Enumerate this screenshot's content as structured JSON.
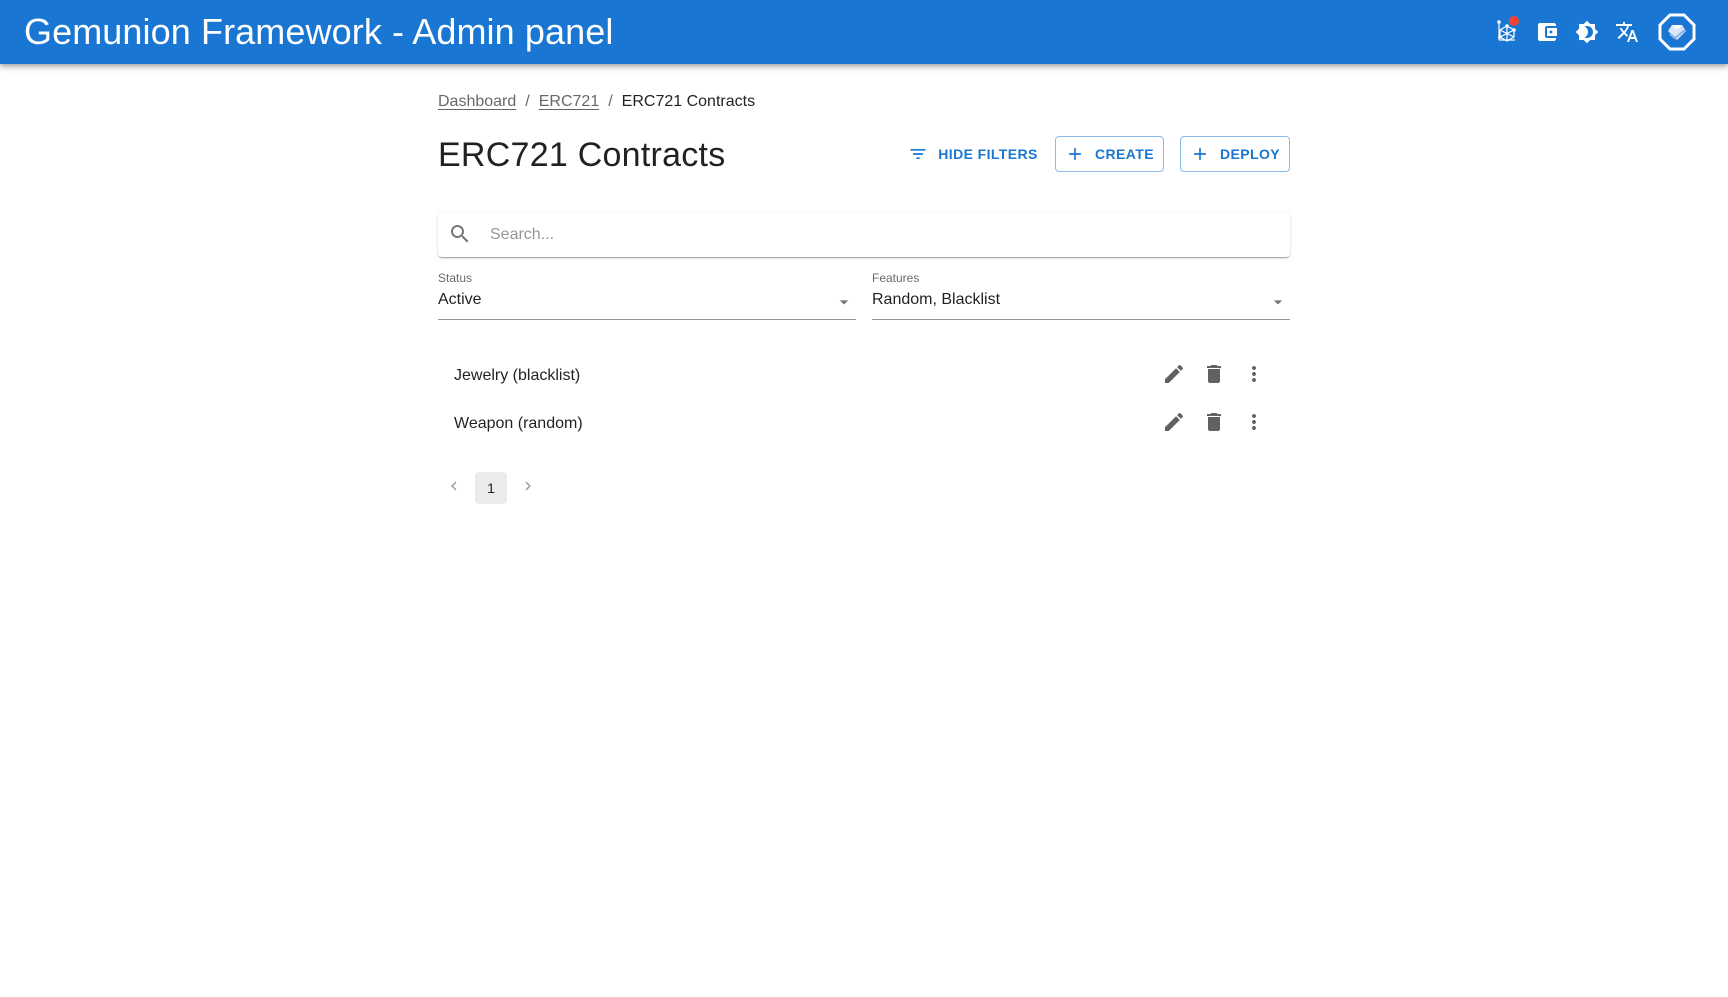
{
  "header": {
    "title": "Gemunion Framework - Admin panel",
    "icons": [
      {
        "name": "network-icon",
        "has_badge": true
      },
      {
        "name": "wallet-icon"
      },
      {
        "name": "brightness-icon"
      },
      {
        "name": "translate-icon"
      },
      {
        "name": "gemunion-logo-icon"
      }
    ],
    "colors": {
      "appbar": "#1976d2",
      "badge": "#f44336"
    }
  },
  "breadcrumbs": [
    {
      "label": "Dashboard",
      "link": true
    },
    {
      "label": "ERC721",
      "link": true
    },
    {
      "label": "ERC721 Contracts",
      "link": false
    }
  ],
  "breadcrumb_separator": "/",
  "page": {
    "title": "ERC721 Contracts",
    "buttons": {
      "hide_filters": "Hide filters",
      "create": "Create",
      "deploy": "Deploy"
    }
  },
  "search": {
    "placeholder": "Search...",
    "value": ""
  },
  "filters": {
    "status": {
      "label": "Status",
      "value": "Active"
    },
    "features": {
      "label": "Features",
      "value": "Random, Blacklist"
    }
  },
  "list": {
    "items": [
      {
        "title": "Jewelry (blacklist)"
      },
      {
        "title": "Weapon (random)"
      }
    ]
  },
  "pagination": {
    "current_page": "1",
    "pages": 1
  }
}
